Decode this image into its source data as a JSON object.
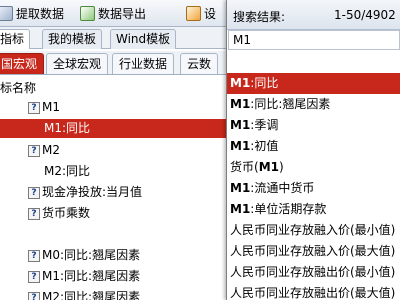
{
  "toolbar": {
    "extract_label": "提取数据",
    "export_label": "数据导出",
    "settings_label": "设"
  },
  "tabs": [
    {
      "label": "指标"
    },
    {
      "label": "我的模板"
    },
    {
      "label": "Wind模板"
    }
  ],
  "subtabs": [
    {
      "label": "国宏观"
    },
    {
      "label": "全球宏观"
    },
    {
      "label": "行业数据"
    },
    {
      "label": "云数"
    }
  ],
  "tree": {
    "header": "标名称",
    "nodes": [
      {
        "label": "M1"
      },
      {
        "label": "M1:同比"
      },
      {
        "label": "M2"
      },
      {
        "label": "M2:同比"
      },
      {
        "label": "现金净投放:当月值"
      },
      {
        "label": "货币乘数"
      },
      {
        "label": "M0:同比:翘尾因素"
      },
      {
        "label": "M1:同比:翘尾因素"
      },
      {
        "label": "M2:同比:翘尾因素"
      }
    ]
  },
  "search": {
    "title": "搜索结果:",
    "count": "1-50/4902",
    "query": "M1",
    "results": [
      {
        "pre": "",
        "bold": "M1",
        "post": ":同比"
      },
      {
        "pre": "",
        "bold": "M1",
        "post": ":同比:翘尾因素"
      },
      {
        "pre": "",
        "bold": "M1",
        "post": ":季调"
      },
      {
        "pre": "",
        "bold": "M1",
        "post": ":初值"
      },
      {
        "pre": "货币(",
        "bold": "M1",
        "post": ")"
      },
      {
        "pre": "",
        "bold": "M1",
        "post": ":流通中货币"
      },
      {
        "pre": "",
        "bold": "M1",
        "post": ":单位活期存款"
      },
      {
        "pre": "人民币同业存放融入价(最小值)",
        "bold": "",
        "post": ""
      },
      {
        "pre": "人民币同业存放融入价(最大值)",
        "bold": "",
        "post": ""
      },
      {
        "pre": "人民币同业存放融出价(最小值)",
        "bold": "",
        "post": ""
      },
      {
        "pre": "人民币同业存放融出价(最大值)",
        "bold": "",
        "post": ""
      }
    ]
  },
  "colors": {
    "selection": "#c8281c"
  }
}
